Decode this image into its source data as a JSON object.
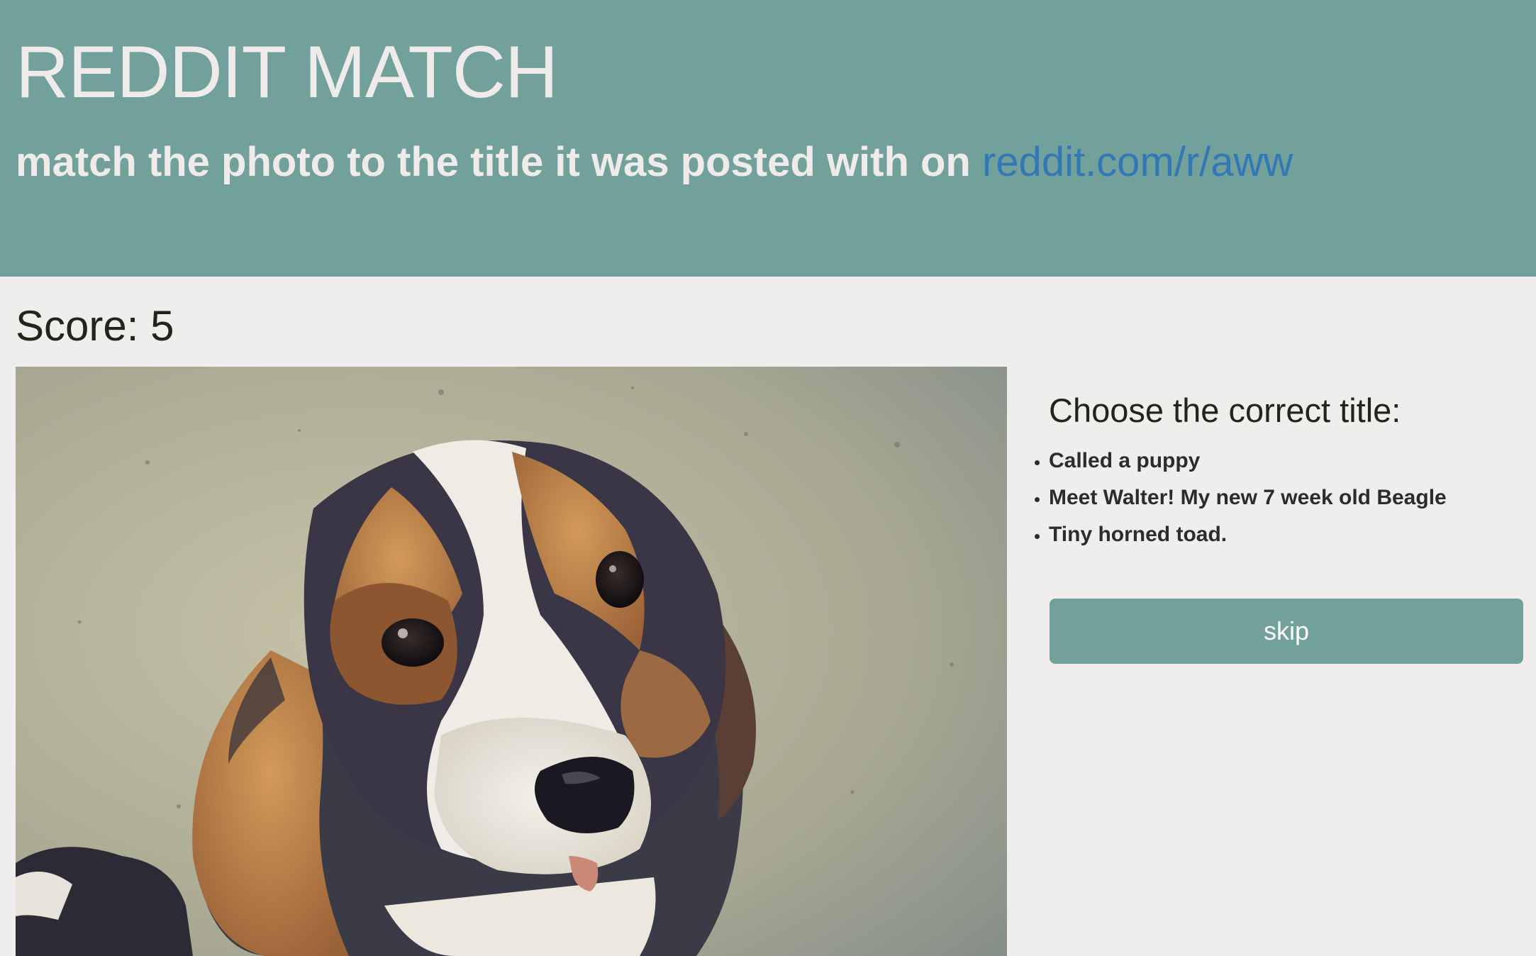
{
  "header": {
    "title": "REDDIT MATCH",
    "tagline_text": "match the photo to the title it was posted with on ",
    "tagline_link": "reddit.com/r/aww"
  },
  "score": {
    "text": "Score: 5",
    "value": 5
  },
  "photo": {
    "subject": "beagle puppy on concrete"
  },
  "choices": {
    "heading": "Choose the correct title:",
    "options": [
      "Called a puppy",
      "Meet Walter! My new 7 week old Beagle",
      "Tiny horned toad."
    ]
  },
  "skip": {
    "label": "skip"
  },
  "colors": {
    "header_bg": "#71a19a",
    "page_bg": "#f0eded",
    "link": "#3278b7",
    "button_bg": "#71a19a",
    "header_text": "#efebeb"
  }
}
